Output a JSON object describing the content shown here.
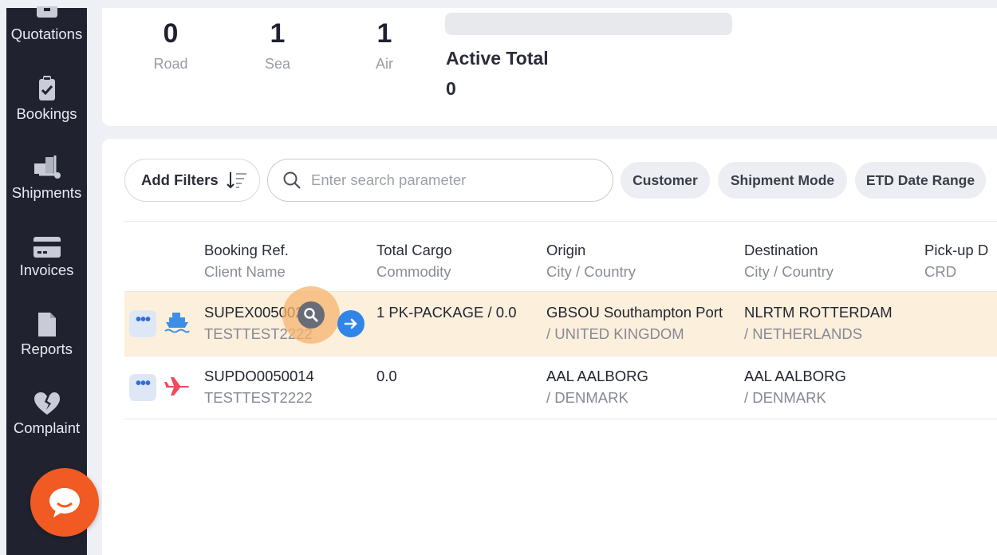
{
  "sidebar": {
    "items": [
      {
        "label": "Quotations",
        "icon": "briefcase-icon"
      },
      {
        "label": "Bookings",
        "icon": "clipboard-check-icon"
      },
      {
        "label": "Shipments",
        "icon": "boxes-dolly-icon"
      },
      {
        "label": "Invoices",
        "icon": "credit-card-icon"
      },
      {
        "label": "Reports",
        "icon": "document-icon"
      },
      {
        "label": "Complaint",
        "icon": "broken-heart-icon"
      }
    ]
  },
  "stats": {
    "road": {
      "value": "0",
      "label": "Road"
    },
    "sea": {
      "value": "1",
      "label": "Sea"
    },
    "air": {
      "value": "1",
      "label": "Air"
    },
    "active_total": {
      "label": "Active Total",
      "value": "0"
    }
  },
  "filters": {
    "add_filters_label": "Add Filters",
    "search_placeholder": "Enter search parameter",
    "chips": [
      "Customer",
      "Shipment Mode",
      "ETD Date Range"
    ]
  },
  "table": {
    "columns": [
      {
        "primary": "Booking Ref.",
        "secondary": "Client Name"
      },
      {
        "primary": "Total Cargo",
        "secondary": "Commodity"
      },
      {
        "primary": "Origin",
        "secondary": "City / Country"
      },
      {
        "primary": "Destination",
        "secondary": "City / Country"
      },
      {
        "primary": "Pick-up D",
        "secondary": "CRD"
      }
    ],
    "rows": [
      {
        "mode": "sea",
        "booking_ref": "SUPEX0050021",
        "client": "TESTTEST2222",
        "cargo": "1 PK-PACKAGE / 0.0",
        "origin_city": "GBSOU Southampton Port",
        "origin_country": "/ UNITED KINGDOM",
        "dest_city": "NLRTM ROTTERDAM",
        "dest_country": "/ NETHERLANDS"
      },
      {
        "mode": "air",
        "booking_ref": "SUPDO0050014",
        "client": "TESTTEST2222",
        "cargo": "0.0",
        "origin_city": "AAL AALBORG",
        "origin_country": "/ DENMARK",
        "dest_city": "AAL AALBORG",
        "dest_country": "/ DENMARK"
      }
    ]
  },
  "colors": {
    "sidebar": "#20232f",
    "accent": "#f15a22",
    "highlight_row": "#fcf0dd",
    "link_blue": "#2f86e8"
  }
}
